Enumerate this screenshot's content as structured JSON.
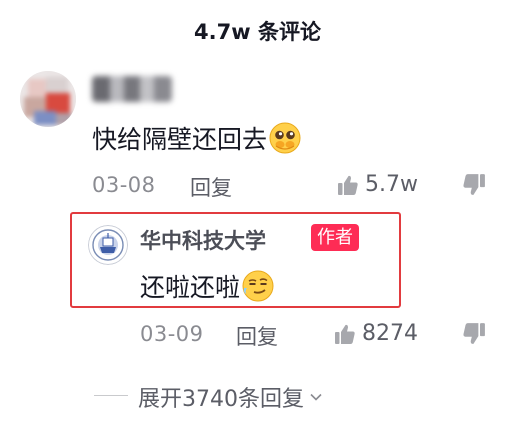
{
  "header": {
    "title": "4.7w 条评论"
  },
  "comment": {
    "text": "快给隔壁还回去",
    "emoji": "pleading-face-emoji",
    "date": "03-08",
    "reply_label": "回复",
    "like_count": "5.7w"
  },
  "author_reply": {
    "author": "华中科技大学",
    "badge": "作者",
    "text": "还啦还啦",
    "emoji": "smirking-face-emoji",
    "date": "03-09",
    "reply_label": "回复",
    "like_count": "8274",
    "highlight_color": "#e23b3f"
  },
  "expand": {
    "label": "展开3740条回复"
  },
  "colors": {
    "accent": "#fe2c55",
    "meta": "#8a8b91"
  }
}
